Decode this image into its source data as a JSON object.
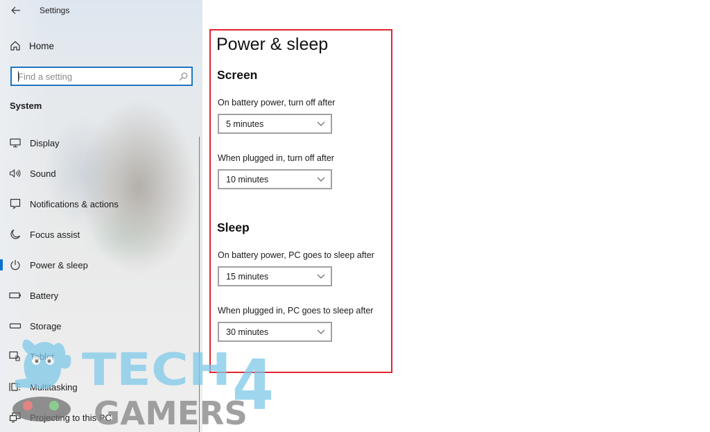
{
  "window": {
    "title": "Settings",
    "back_label": "←"
  },
  "sidebar": {
    "home_label": "Home",
    "search": {
      "placeholder": "Find a setting",
      "value": ""
    },
    "section_label": "System",
    "items": [
      {
        "label": "Display",
        "icon": "monitor-icon",
        "active": false
      },
      {
        "label": "Sound",
        "icon": "speaker-icon",
        "active": false
      },
      {
        "label": "Notifications & actions",
        "icon": "notification-icon",
        "active": false
      },
      {
        "label": "Focus assist",
        "icon": "moon-icon",
        "active": false
      },
      {
        "label": "Power & sleep",
        "icon": "power-icon",
        "active": true
      },
      {
        "label": "Battery",
        "icon": "battery-icon",
        "active": false
      },
      {
        "label": "Storage",
        "icon": "storage-icon",
        "active": false
      },
      {
        "label": "Tablet",
        "icon": "tablet-icon",
        "active": false
      },
      {
        "label": "Multitasking",
        "icon": "multitasking-icon",
        "active": false
      },
      {
        "label": "Projecting to this PC",
        "icon": "projecting-icon",
        "active": false
      }
    ]
  },
  "main": {
    "title": "Power & sleep",
    "screen": {
      "heading": "Screen",
      "battery_label": "On battery power, turn off after",
      "battery_value": "5 minutes",
      "plugged_label": "When plugged in, turn off after",
      "plugged_value": "10 minutes"
    },
    "sleep": {
      "heading": "Sleep",
      "battery_label": "On battery power, PC goes to sleep after",
      "battery_value": "15 minutes",
      "plugged_label": "When plugged in, PC goes to sleep after",
      "plugged_value": "30 minutes"
    }
  },
  "watermark": {
    "line1": "TECH",
    "line1_digit": "4",
    "line2": "GAMERS"
  },
  "colors": {
    "accent": "#0b6fd2",
    "search_border": "#1f74c4",
    "highlight": "#e3232f",
    "watermark_blue": "#7ec8e8",
    "watermark_gray": "#8a8a8a"
  }
}
